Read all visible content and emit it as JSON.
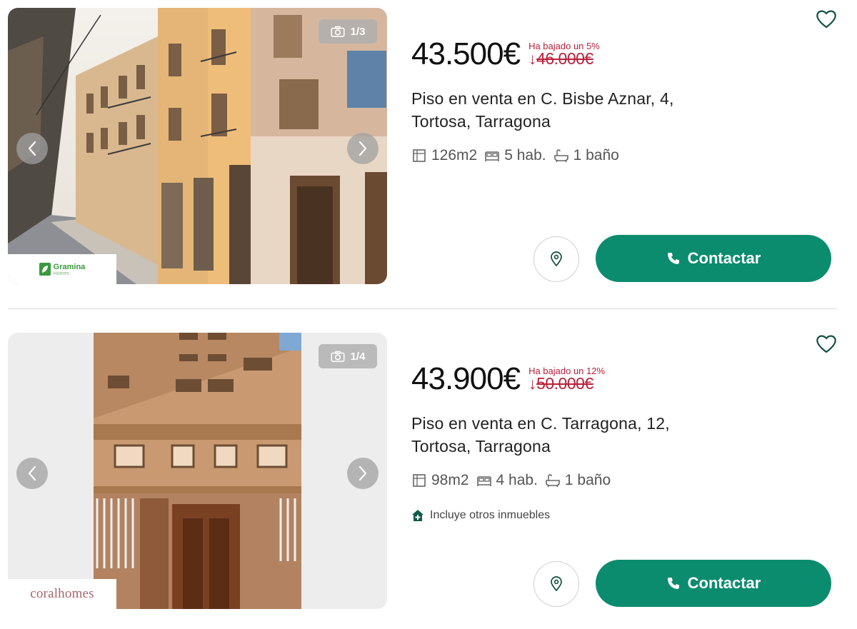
{
  "colors": {
    "accent": "#0c8c6e",
    "price_drop": "#b8213b"
  },
  "listings": [
    {
      "photo_counter": "1/3",
      "agency": {
        "name": "Gramina",
        "sub": "Homes"
      },
      "price": "43.500€",
      "drop_note": "Ha bajado un 5%",
      "old_price_arrow": "↓",
      "old_price": "46.000€",
      "title_line1": "Piso en venta en C. Bisbe Aznar, 4,",
      "title_line2": "Tortosa, Tarragona",
      "area": "126m2",
      "rooms": "5 hab.",
      "baths": "1 baño",
      "contact_label": "Contactar"
    },
    {
      "photo_counter": "1/4",
      "agency": {
        "name": "coralhomes"
      },
      "price": "43.900€",
      "drop_note": "Ha bajado un 12%",
      "old_price_arrow": "↓",
      "old_price": "50.000€",
      "title_line1": "Piso en venta en C. Tarragona, 12,",
      "title_line2": "Tortosa, Tarragona",
      "area": "98m2",
      "rooms": "4 hab.",
      "baths": "1 baño",
      "extra": "Incluye otros inmuebles",
      "contact_label": "Contactar"
    }
  ]
}
